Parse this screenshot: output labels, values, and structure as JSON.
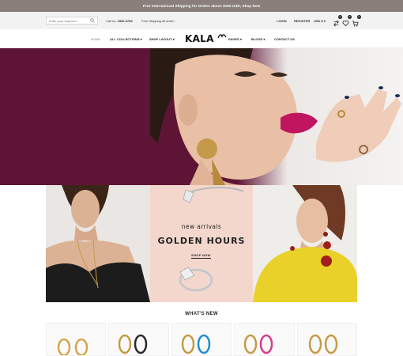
{
  "promo": {
    "text": "Free International Shipping for Orders above $150 USD, Shop Now"
  },
  "topbar": {
    "search_placeholder": "Enter your keyword...",
    "phone_label": "Call us:",
    "phone_number": "1800-6789",
    "shipping": "Free Shipping all order!",
    "login": "LOGIN",
    "register": "REGISTER",
    "currency": "USD $",
    "badges": {
      "compare": "0",
      "wishlist": "0",
      "cart": "0"
    }
  },
  "nav": {
    "home": "HOME",
    "collections": "ALL COLLECTIONS",
    "shop_layout": "SHOP LAYOUT",
    "logo": "KALA",
    "pages": "PAGES",
    "blogs": "BLOGS",
    "contact": "CONTACT US"
  },
  "banner": {
    "subtitle": "new arrivals",
    "title": "GOLDEN HOURS",
    "cta": "SHOP NOW"
  },
  "section": {
    "title": "WHAT'S NEW"
  },
  "colors": {
    "hero_bg": "#5e1434",
    "promo_bg": "#8a7f7a",
    "banner_pink": "#f3d7cc",
    "sweater_yellow": "#e9d12a"
  },
  "icons": [
    "search-icon",
    "compare-icon",
    "heart-icon",
    "cart-icon",
    "chevron-down-icon"
  ]
}
